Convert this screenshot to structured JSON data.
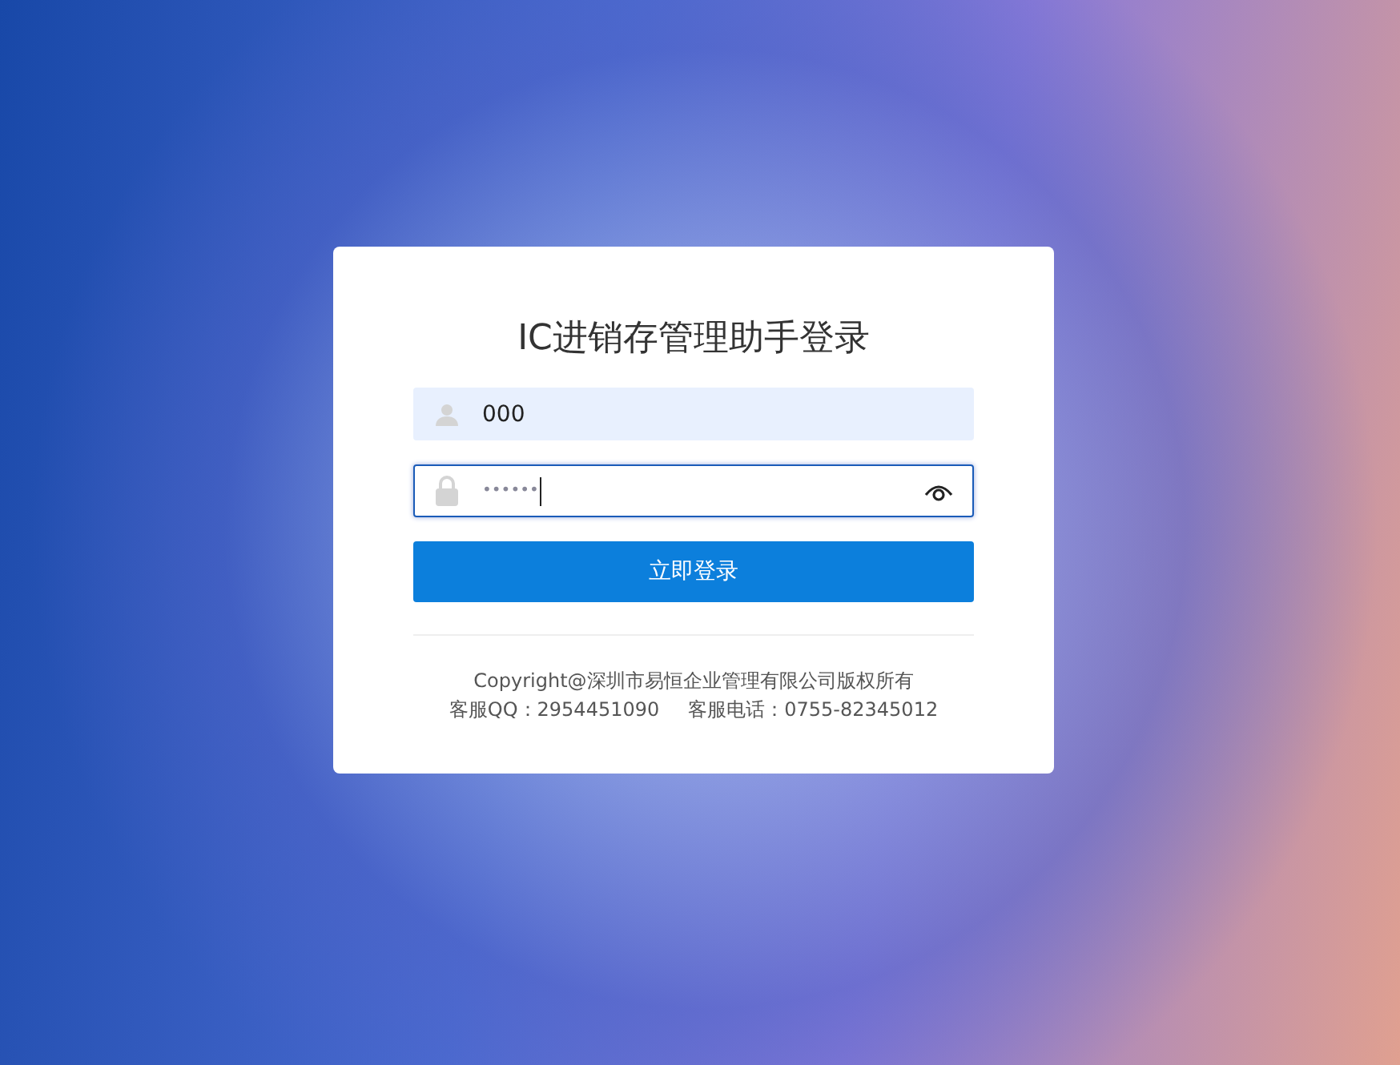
{
  "title": "IC进销存管理助手登录",
  "fields": [
    {
      "kind": "user",
      "value": "000",
      "focused": false
    },
    {
      "kind": "password",
      "value": "••••••",
      "focused": true
    }
  ],
  "login_button": "立即登录",
  "footer": {
    "copyright": "Copyright@深圳市易恒企业管理有限公司版权所有",
    "qq": "客服QQ：2954451090",
    "phone": "客服电话：0755-82345012"
  }
}
